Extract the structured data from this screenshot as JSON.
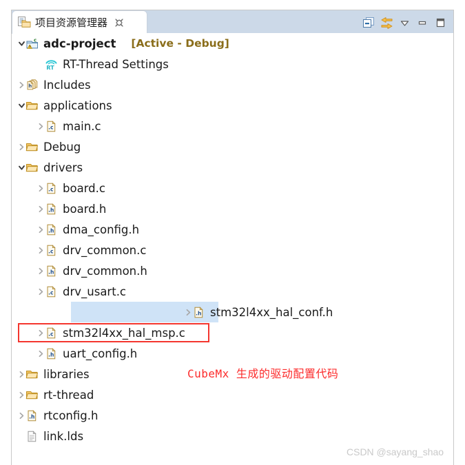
{
  "window": {
    "tab": {
      "label": "项目资源管理器",
      "icon": "project-explorer-icon",
      "close_icon": "close-icon"
    },
    "toolbar": [
      {
        "name": "collapse-all-button",
        "icon": "collapse-all-icon"
      },
      {
        "name": "link-with-editor-button",
        "icon": "link-editor-icon"
      },
      {
        "name": "view-menu-button",
        "icon": "chevron-down-icon"
      },
      {
        "name": "minimize-button",
        "icon": "minimize-icon"
      },
      {
        "name": "maximize-button",
        "icon": "maximize-icon"
      }
    ]
  },
  "tree": {
    "rows": [
      {
        "indent": 0,
        "twisty": "expanded",
        "icon": "project-icon",
        "label": "adc-project",
        "bold": true,
        "suffix": "[Active - Debug]",
        "selected": false,
        "boxed": false
      },
      {
        "indent": 1,
        "twisty": "none",
        "icon": "rt-thread-icon",
        "label": "RT-Thread Settings",
        "bold": false,
        "suffix": "",
        "selected": false,
        "boxed": false
      },
      {
        "indent": 0,
        "twisty": "collapsed",
        "icon": "includes-icon",
        "label": "Includes",
        "bold": false,
        "suffix": "",
        "selected": false,
        "boxed": false
      },
      {
        "indent": 0,
        "twisty": "expanded",
        "icon": "folder-icon",
        "label": "applications",
        "bold": false,
        "suffix": "",
        "selected": false,
        "boxed": false
      },
      {
        "indent": 1,
        "twisty": "collapsed",
        "icon": "c-file-icon",
        "label": "main.c",
        "bold": false,
        "suffix": "",
        "selected": false,
        "boxed": false
      },
      {
        "indent": 0,
        "twisty": "collapsed",
        "icon": "folder-icon",
        "label": "Debug",
        "bold": false,
        "suffix": "",
        "selected": false,
        "boxed": false
      },
      {
        "indent": 0,
        "twisty": "expanded",
        "icon": "folder-icon",
        "label": "drivers",
        "bold": false,
        "suffix": "",
        "selected": false,
        "boxed": false
      },
      {
        "indent": 1,
        "twisty": "collapsed",
        "icon": "c-file-icon",
        "label": "board.c",
        "bold": false,
        "suffix": "",
        "selected": false,
        "boxed": false
      },
      {
        "indent": 1,
        "twisty": "collapsed",
        "icon": "h-file-icon",
        "label": "board.h",
        "bold": false,
        "suffix": "",
        "selected": false,
        "boxed": false
      },
      {
        "indent": 1,
        "twisty": "collapsed",
        "icon": "h-file-icon",
        "label": "dma_config.h",
        "bold": false,
        "suffix": "",
        "selected": false,
        "boxed": false
      },
      {
        "indent": 1,
        "twisty": "collapsed",
        "icon": "c-file-icon",
        "label": "drv_common.c",
        "bold": false,
        "suffix": "",
        "selected": false,
        "boxed": false
      },
      {
        "indent": 1,
        "twisty": "collapsed",
        "icon": "h-file-icon",
        "label": "drv_common.h",
        "bold": false,
        "suffix": "",
        "selected": false,
        "boxed": false
      },
      {
        "indent": 1,
        "twisty": "collapsed",
        "icon": "c-file-icon",
        "label": "drv_usart.c",
        "bold": false,
        "suffix": "",
        "selected": false,
        "boxed": false
      },
      {
        "indent": 1,
        "twisty": "collapsed",
        "icon": "h-file-icon",
        "label": "stm32l4xx_hal_conf.h",
        "bold": false,
        "suffix": "",
        "selected": true,
        "boxed": false
      },
      {
        "indent": 1,
        "twisty": "collapsed",
        "icon": "c-file-icon",
        "label": "stm32l4xx_hal_msp.c",
        "bold": false,
        "suffix": "",
        "selected": false,
        "boxed": true
      },
      {
        "indent": 1,
        "twisty": "collapsed",
        "icon": "h-file-icon",
        "label": "uart_config.h",
        "bold": false,
        "suffix": "",
        "selected": false,
        "boxed": false
      },
      {
        "indent": 0,
        "twisty": "collapsed",
        "icon": "folder-icon",
        "label": "libraries",
        "bold": false,
        "suffix": "",
        "selected": false,
        "boxed": false
      },
      {
        "indent": 0,
        "twisty": "collapsed",
        "icon": "folder-icon",
        "label": "rt-thread",
        "bold": false,
        "suffix": "",
        "selected": false,
        "boxed": false
      },
      {
        "indent": 0,
        "twisty": "collapsed",
        "icon": "h-file-icon",
        "label": "rtconfig.h",
        "bold": false,
        "suffix": "",
        "selected": false,
        "boxed": false
      },
      {
        "indent": 0,
        "twisty": "none",
        "icon": "generic-file-icon",
        "label": "link.lds",
        "bold": false,
        "suffix": "",
        "selected": false,
        "boxed": false
      }
    ]
  },
  "annotation": {
    "text": "CubeMx 生成的驱动配置代码",
    "color": "#fc2b2b"
  },
  "watermark": {
    "text": "CSDN @sayang_shao"
  },
  "colors": {
    "tab_strip_bg": "#ccd9e8",
    "selection_bg": "#cfe3f7",
    "highlight_box": "#f4352e",
    "active_tag": "#8a6d1a"
  }
}
